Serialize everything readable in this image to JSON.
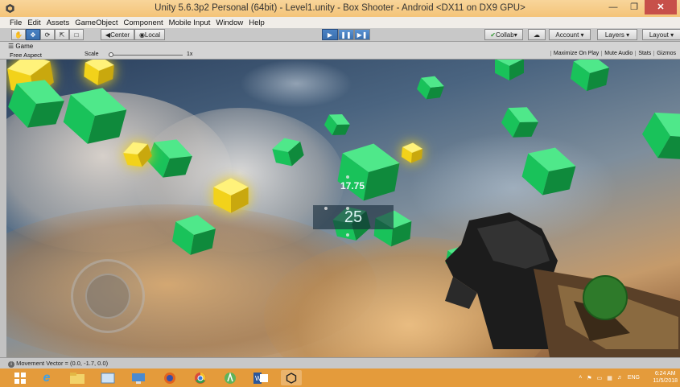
{
  "window": {
    "title": "Unity 5.6.3p2 Personal (64bit) - Level1.unity - Box Shooter - Android <DX11 on DX9 GPU>"
  },
  "menu": [
    "File",
    "Edit",
    "Assets",
    "GameObject",
    "Component",
    "Mobile Input",
    "Window",
    "Help"
  ],
  "toolbar": {
    "pivot_label": "Center",
    "space_label": "Local",
    "collab_label": "Collab",
    "account_label": "Account",
    "layers_label": "Layers",
    "layout_label": "Layout"
  },
  "game_view": {
    "tab_label": "Game",
    "aspect_label": "Free Aspect",
    "scale_label": "Scale",
    "scale_value": "1x",
    "options": [
      "Maximize On Play",
      "Mute Audio",
      "Stats",
      "Gizmos"
    ]
  },
  "hud": {
    "time": "17.75",
    "score": "25"
  },
  "status": {
    "message": "Movement Vector = (0.0, -1.7, 0.0)"
  },
  "taskbar": {
    "language": "ENG",
    "time": "6:24 AM",
    "date": "11/5/2018"
  },
  "colors": {
    "title_bar": "#f4c479",
    "taskbar": "#e49b3b",
    "cube_green": "#19c25a",
    "cube_yellow": "#f2d21a",
    "fire_button": "#2e7a2a",
    "play_active": "#3a6fae"
  }
}
